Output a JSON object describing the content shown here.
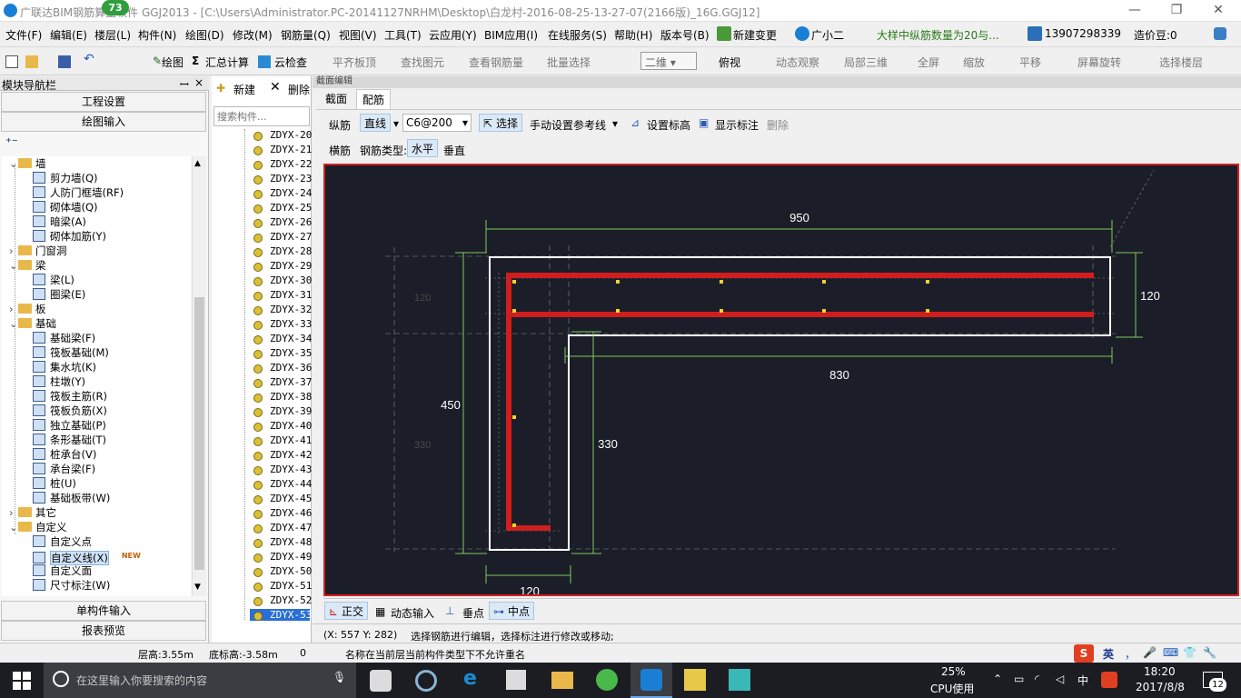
{
  "window": {
    "title": "广联达BIM钢筋算量软件 GGJ2013 - [C:\\Users\\Administrator.PC-20141127NRHM\\Desktop\\白龙村-2016-08-25-13-27-07(2166版)_16G.GGJ12]",
    "badge": "73",
    "min": "—",
    "restore": "❐",
    "close": "✕"
  },
  "menu": [
    "文件(F)",
    "编辑(E)",
    "楼层(L)",
    "构件(N)",
    "绘图(D)",
    "修改(M)",
    "钢筋量(Q)",
    "视图(V)",
    "工具(T)",
    "云应用(Y)",
    "BIM应用(I)",
    "在线服务(S)",
    "帮助(H)",
    "版本号(B)",
    "新建变更",
    "广小二"
  ],
  "menu_notice": "大样中纵筋数量为20与...",
  "menu_account": "13907298339",
  "menu_price": "造价豆:0",
  "toolbar": {
    "draw": "绘图",
    "sum": "汇总计算",
    "cloud": "云检查",
    "align": "平齐板顶",
    "find": "查找图元",
    "view_rebar": "查看钢筋量",
    "batch": "批量选择",
    "view_mode": "二维",
    "top_view": "俯视",
    "dynamic": "动态观察",
    "local3d": "局部三维",
    "fullscreen": "全屏",
    "zoom": "缩放",
    "pan": "平移",
    "rotate": "屏幕旋转",
    "select_floor": "选择楼层"
  },
  "nav": {
    "header": "模块导航栏",
    "pin": "ꟷ",
    "close": "×",
    "btn_project": "工程设置",
    "btn_draw": "绘图输入",
    "btn_single": "单构件输入",
    "btn_report": "报表预览",
    "tree": [
      {
        "t": "墙",
        "lvl": 0,
        "exp": "⌄",
        "folder": true
      },
      {
        "t": "剪力墙(Q)",
        "lvl": 1
      },
      {
        "t": "人防门框墙(RF)",
        "lvl": 1
      },
      {
        "t": "砌体墙(Q)",
        "lvl": 1
      },
      {
        "t": "暗梁(A)",
        "lvl": 1
      },
      {
        "t": "砌体加筋(Y)",
        "lvl": 1
      },
      {
        "t": "门窗洞",
        "lvl": 0,
        "exp": "›",
        "folder": true
      },
      {
        "t": "梁",
        "lvl": 0,
        "exp": "⌄",
        "folder": true
      },
      {
        "t": "梁(L)",
        "lvl": 1
      },
      {
        "t": "圈梁(E)",
        "lvl": 1
      },
      {
        "t": "板",
        "lvl": 0,
        "exp": "›",
        "folder": true
      },
      {
        "t": "基础",
        "lvl": 0,
        "exp": "⌄",
        "folder": true
      },
      {
        "t": "基础梁(F)",
        "lvl": 1
      },
      {
        "t": "筏板基础(M)",
        "lvl": 1
      },
      {
        "t": "集水坑(K)",
        "lvl": 1
      },
      {
        "t": "柱墩(Y)",
        "lvl": 1
      },
      {
        "t": "筏板主筋(R)",
        "lvl": 1
      },
      {
        "t": "筏板负筋(X)",
        "lvl": 1
      },
      {
        "t": "独立基础(P)",
        "lvl": 1
      },
      {
        "t": "条形基础(T)",
        "lvl": 1
      },
      {
        "t": "桩承台(V)",
        "lvl": 1
      },
      {
        "t": "承台梁(F)",
        "lvl": 1
      },
      {
        "t": "桩(U)",
        "lvl": 1
      },
      {
        "t": "基础板带(W)",
        "lvl": 1
      },
      {
        "t": "其它",
        "lvl": 0,
        "exp": "›",
        "folder": true
      },
      {
        "t": "自定义",
        "lvl": 0,
        "exp": "⌄",
        "folder": true
      },
      {
        "t": "自定义点",
        "lvl": 1
      },
      {
        "t": "自定义线(X)",
        "lvl": 1,
        "sel": true,
        "new": "NEW"
      },
      {
        "t": "自定义面",
        "lvl": 1
      },
      {
        "t": "尺寸标注(W)",
        "lvl": 1
      }
    ]
  },
  "complist": {
    "new": "新建",
    "delete": "删除",
    "search_placeholder": "搜索构件...",
    "items": [
      "ZDYX-20",
      "ZDYX-21",
      "ZDYX-22",
      "ZDYX-23",
      "ZDYX-24",
      "ZDYX-25",
      "ZDYX-26",
      "ZDYX-27",
      "ZDYX-28",
      "ZDYX-29",
      "ZDYX-30",
      "ZDYX-31",
      "ZDYX-32",
      "ZDYX-33",
      "ZDYX-34",
      "ZDYX-35",
      "ZDYX-36",
      "ZDYX-37",
      "ZDYX-38",
      "ZDYX-39",
      "ZDYX-40",
      "ZDYX-41",
      "ZDYX-42",
      "ZDYX-43",
      "ZDYX-44",
      "ZDYX-45",
      "ZDYX-46",
      "ZDYX-47",
      "ZDYX-48",
      "ZDYX-49",
      "ZDYX-50",
      "ZDYX-51",
      "ZDYX-52",
      "ZDYX-53"
    ],
    "selected": "ZDYX-53"
  },
  "editor": {
    "panel_title": "截面编辑",
    "tab_section": "截面",
    "tab_rebar": "配筋",
    "long_bar": "纵筋",
    "line": "直线",
    "spec": "C6@200",
    "select": "选择",
    "ref_line": "手动设置参考线",
    "set_elev": "设置标高",
    "show_label": "显示标注",
    "delete": "删除",
    "cross_bar": "横筋",
    "bar_type": "钢筋类型:",
    "horizontal": "水平",
    "vertical": "垂直",
    "dims": {
      "top": "950",
      "right": "120",
      "mid": "830",
      "left": "450",
      "inner": "330",
      "bottom": "120",
      "ghost1": "120",
      "ghost2": "330"
    },
    "bottom": {
      "ortho": "正交",
      "dyn_input": "动态输入",
      "perp": "垂点",
      "mid": "中点"
    },
    "coords": "(X: 557 Y: 282)",
    "hint": "选择钢筋进行编辑，选择标注进行修改或移动;"
  },
  "status": {
    "floor_h": "层高:3.55m",
    "base_h": "底标高:-3.58m",
    "zero": "0",
    "msg": "名称在当前层当前构件类型下不允许重名"
  },
  "ime": {
    "lang": "英",
    "items": [
      "，",
      "🎤",
      "⌨",
      "👕",
      "🔧"
    ]
  },
  "taskbar": {
    "search": "在这里输入你要搜索的内容",
    "cpu_pct": "25%",
    "cpu_label": "CPU使用",
    "time": "18:20",
    "date": "2017/8/8",
    "lang": "中",
    "notif": "12"
  },
  "colors": {
    "rebar": "#d01e1e",
    "canvas": "#1b1e28",
    "dim": "#7ecb5c",
    "outline": "#ffffff",
    "point": "#f2d22a"
  }
}
